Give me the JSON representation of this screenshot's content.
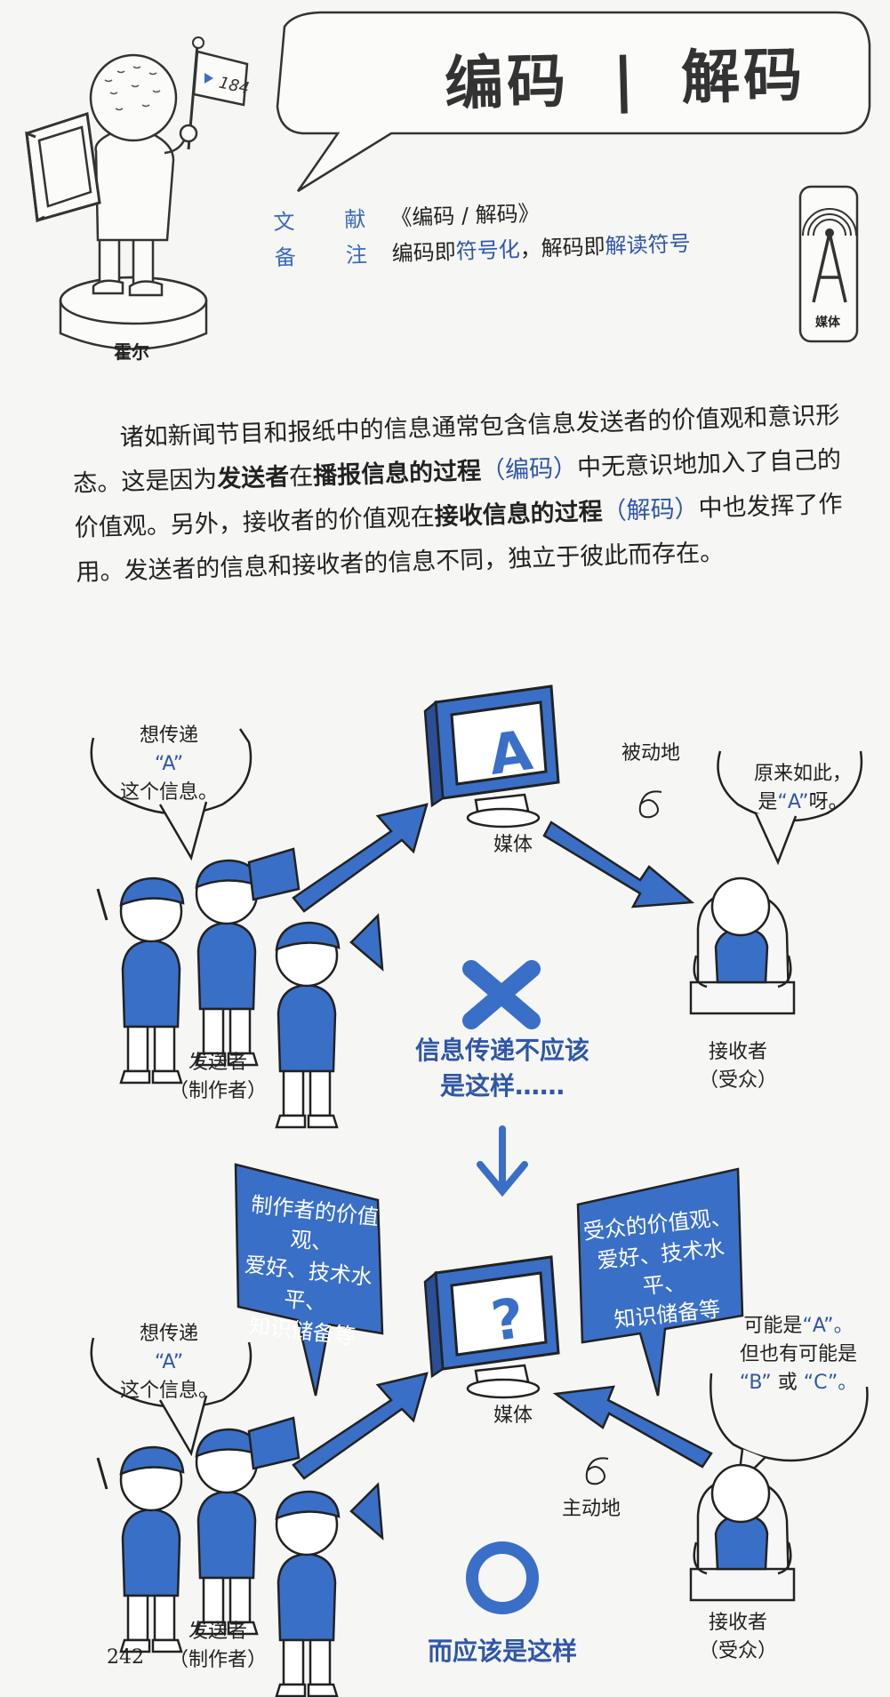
{
  "header": {
    "flag_number": "184",
    "person_name": "霍尔",
    "title_left": "编码",
    "title_sep": "|",
    "title_right": "解码",
    "ref_key": "文　献",
    "ref_value": "《编码 / 解码》",
    "note_key": "备　注",
    "note_prefix": "编码即",
    "note_hl1": "符号化",
    "note_mid": "，解码即",
    "note_hl2": "解读符号",
    "badge_label": "媒体"
  },
  "body": {
    "p1": "诸如新闻节目和报纸中的信息通常包含信息发送者的价值观和意识形态。这是因为",
    "sender": "发送者",
    "p2": "在",
    "process_send": "播报信息的过程",
    "encode_paren": "（编码）",
    "p3": "中无意识地加入了自己的价值观。另外，接收者的价值观在",
    "process_receive": "接收信息的过程",
    "decode_paren": "（解码）",
    "p4": "中也发挥了作用。发送者的信息和接收者的信息不同，独立于彼此而存在。"
  },
  "diagram_top": {
    "sender_bubble_1": "想传递",
    "sender_bubble_2": "“A”",
    "sender_bubble_3": "这个信息。",
    "media_letter": "A",
    "media_label": "媒体",
    "passive_label": "被动地",
    "receiver_bubble_1": "原来如此，",
    "receiver_bubble_2a": "是",
    "receiver_bubble_2b": "“A”",
    "receiver_bubble_2c": "呀。",
    "sender_label": "发送者",
    "sender_sub": "（制作者）",
    "receiver_label": "接收者",
    "receiver_sub": "（受众）",
    "wrong_mark": "✕",
    "wrong_caption_1": "信息传递不应该",
    "wrong_caption_2": "是这样……"
  },
  "diagram_bottom": {
    "sender_bubble_1": "想传递",
    "sender_bubble_2": "“A”",
    "sender_bubble_3": "这个信息。",
    "producer_panel": [
      "制作者的价值观、",
      "爱好、技术水平、",
      "知识储备等"
    ],
    "audience_panel": [
      "受众的价值观、",
      "爱好、技术水平、",
      "知识储备等"
    ],
    "media_letter": "?",
    "media_label": "媒体",
    "active_label": "主动地",
    "receiver_bubble_1a": "可能是",
    "receiver_bubble_1b": "“A”。",
    "receiver_bubble_2": "但也有可能是",
    "receiver_bubble_3a": "“B”",
    "receiver_bubble_3b": "或",
    "receiver_bubble_3c": "“C”。",
    "sender_label": "发送者",
    "sender_sub": "（制作者）",
    "receiver_label": "接收者",
    "receiver_sub": "（受众）",
    "right_mark": "○",
    "right_caption": "而应该是这样"
  },
  "footer": {
    "page_number": "242"
  },
  "colors": {
    "accent_blue": "#3a6fc7",
    "dark_blue": "#2f56a8",
    "paper": "#f6f6f4"
  }
}
